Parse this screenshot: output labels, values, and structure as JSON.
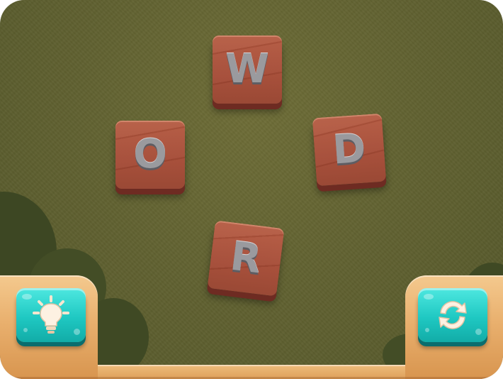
{
  "tiles": [
    {
      "id": "w",
      "letter": "W"
    },
    {
      "id": "o",
      "letter": "O"
    },
    {
      "id": "d",
      "letter": "D"
    },
    {
      "id": "r",
      "letter": "R"
    }
  ],
  "buttons": {
    "hint_icon": "lightbulb-icon",
    "shuffle_icon": "shuffle-arrows-icon"
  },
  "colors": {
    "board": "#5f6030",
    "tile": "#a44a35",
    "letter": "#9a9a9e",
    "button": "#1fc8c2",
    "wood": "#e9b06e"
  }
}
